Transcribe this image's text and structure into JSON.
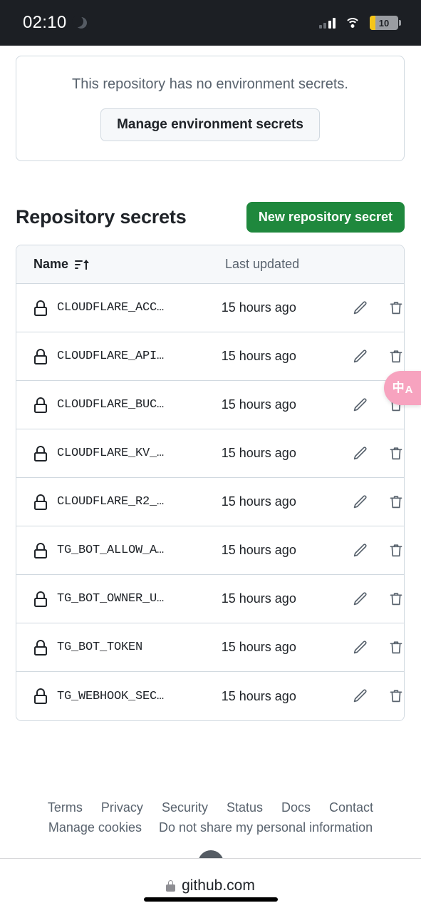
{
  "statusbar": {
    "time": "02:10",
    "dnd_icon": "crescent-moon-icon",
    "signal_icon": "cellular-signal-icon",
    "wifi_icon": "wifi-icon",
    "battery_level": "10"
  },
  "environment_card": {
    "message": "This repository has no environment secrets.",
    "button_label": "Manage environment secrets"
  },
  "section": {
    "title": "Repository secrets",
    "new_button_label": "New repository secret",
    "accent_color": "#1f883d"
  },
  "table": {
    "columns": [
      "Name",
      "Last updated"
    ],
    "sort_icon": "sort-ascending-icon",
    "rows": [
      {
        "icon": "lock-icon",
        "name": "CLOUDFLARE_ACC…",
        "updated": "15 hours ago",
        "edit": "pencil-icon",
        "delete": "trash-icon"
      },
      {
        "icon": "lock-icon",
        "name": "CLOUDFLARE_API…",
        "updated": "15 hours ago",
        "edit": "pencil-icon",
        "delete": "trash-icon"
      },
      {
        "icon": "lock-icon",
        "name": "CLOUDFLARE_BUC…",
        "updated": "15 hours ago",
        "edit": "pencil-icon",
        "delete": "trash-icon"
      },
      {
        "icon": "lock-icon",
        "name": "CLOUDFLARE_KV_…",
        "updated": "15 hours ago",
        "edit": "pencil-icon",
        "delete": "trash-icon"
      },
      {
        "icon": "lock-icon",
        "name": "CLOUDFLARE_R2_…",
        "updated": "15 hours ago",
        "edit": "pencil-icon",
        "delete": "trash-icon"
      },
      {
        "icon": "lock-icon",
        "name": "TG_BOT_ALLOW_A…",
        "updated": "15 hours ago",
        "edit": "pencil-icon",
        "delete": "trash-icon"
      },
      {
        "icon": "lock-icon",
        "name": "TG_BOT_OWNER_U…",
        "updated": "15 hours ago",
        "edit": "pencil-icon",
        "delete": "trash-icon"
      },
      {
        "icon": "lock-icon",
        "name": "TG_BOT_TOKEN",
        "updated": "15 hours ago",
        "edit": "pencil-icon",
        "delete": "trash-icon"
      },
      {
        "icon": "lock-icon",
        "name": "TG_WEBHOOK_SEC…",
        "updated": "15 hours ago",
        "edit": "pencil-icon",
        "delete": "trash-icon"
      }
    ]
  },
  "footer": {
    "row1": [
      "Terms",
      "Privacy",
      "Security",
      "Status",
      "Docs",
      "Contact"
    ],
    "row2": [
      "Manage cookies",
      "Do not share my personal information"
    ]
  },
  "browser": {
    "url": "github.com",
    "lock_icon": "secure-lock-icon"
  },
  "translate_widget": {
    "cn_glyph": "中",
    "en_glyph": "A",
    "color": "#f7a3bf"
  }
}
